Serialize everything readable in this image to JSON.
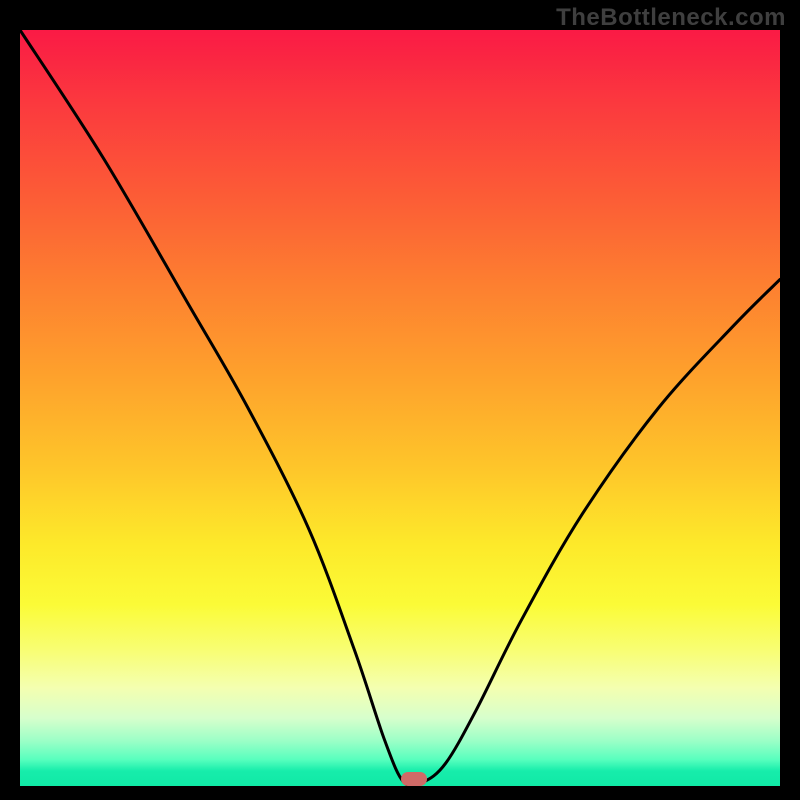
{
  "watermark": "TheBottleneck.com",
  "chart_data": {
    "type": "line",
    "title": "",
    "xlabel": "",
    "ylabel": "",
    "xlim": [
      0,
      100
    ],
    "ylim": [
      0,
      100
    ],
    "grid": false,
    "series": [
      {
        "name": "bottleneck-curve",
        "x": [
          0,
          11,
          22,
          30,
          38,
          44,
          48,
          50.5,
          53,
          56,
          60,
          66,
          74,
          84,
          94,
          100
        ],
        "values": [
          100,
          83,
          64,
          50,
          34,
          18,
          6,
          0.5,
          0.5,
          3,
          10,
          22,
          36,
          50,
          61,
          67
        ]
      }
    ],
    "marker": {
      "x": 51.8,
      "y": 0.9
    },
    "gradient_stops": [
      {
        "pct": 0,
        "color": "#fa1a45"
      },
      {
        "pct": 10,
        "color": "#fb3a3e"
      },
      {
        "pct": 22,
        "color": "#fc5c36"
      },
      {
        "pct": 34,
        "color": "#fd8030"
      },
      {
        "pct": 46,
        "color": "#fea22c"
      },
      {
        "pct": 58,
        "color": "#fec62a"
      },
      {
        "pct": 68,
        "color": "#fde92a"
      },
      {
        "pct": 76,
        "color": "#fbfb37"
      },
      {
        "pct": 82,
        "color": "#f8fe73"
      },
      {
        "pct": 87,
        "color": "#f4ffb0"
      },
      {
        "pct": 91,
        "color": "#d7ffcc"
      },
      {
        "pct": 94,
        "color": "#9cffc7"
      },
      {
        "pct": 96.5,
        "color": "#58ffbe"
      },
      {
        "pct": 98,
        "color": "#17edab"
      },
      {
        "pct": 100,
        "color": "#10e9a6"
      }
    ]
  }
}
